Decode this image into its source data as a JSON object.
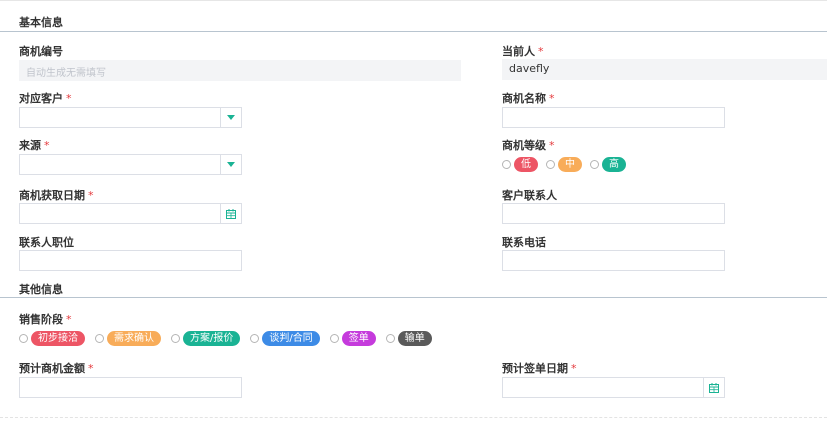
{
  "sections": {
    "basic_title": "基本信息",
    "other_title": "其他信息"
  },
  "fields": {
    "opportunity_no": {
      "label": "商机编号",
      "placeholder": "自动生成无需填写"
    },
    "current_owner": {
      "label": "当前人",
      "required": "*",
      "value": "davefly"
    },
    "customer": {
      "label": "对应客户",
      "required": "*"
    },
    "opportunity_name": {
      "label": "商机名称",
      "required": "*"
    },
    "source": {
      "label": "来源",
      "required": "*"
    },
    "level": {
      "label": "商机等级",
      "required": "*",
      "options": [
        "低",
        "中",
        "高"
      ]
    },
    "acquired_date": {
      "label": "商机获取日期",
      "required": "*"
    },
    "contact": {
      "label": "客户联系人"
    },
    "contact_title": {
      "label": "联系人职位"
    },
    "contact_phone": {
      "label": "联系电话"
    },
    "sales_stage": {
      "label": "销售阶段",
      "required": "*",
      "options": [
        "初步接洽",
        "需求确认",
        "方案/报价",
        "谈判/合同",
        "签单",
        "输单"
      ]
    },
    "expected_amount": {
      "label": "预计商机金额",
      "required": "*"
    },
    "expected_sign_date": {
      "label": "预计签单日期",
      "required": "*"
    }
  },
  "colors": {
    "accent": "#1ab394",
    "level": [
      "#ed5565",
      "#f8ac59",
      "#1ab394"
    ],
    "stage": [
      "#ed5565",
      "#f8ac59",
      "#1ab394",
      "#3d8be6",
      "#c53bdc",
      "#5a5a5a"
    ]
  },
  "icons": {
    "dropdown": "caret-down-icon",
    "calendar": "calendar-icon"
  }
}
